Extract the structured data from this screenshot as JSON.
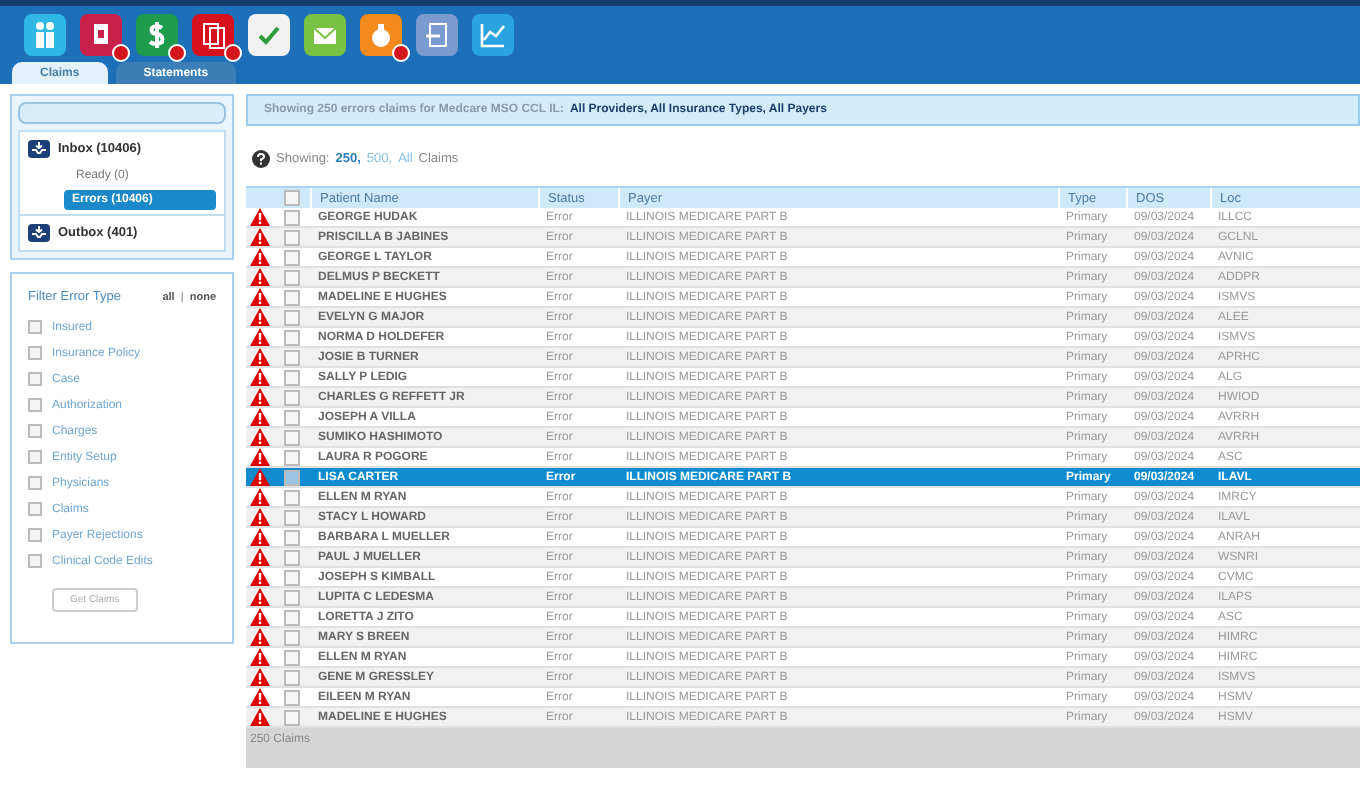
{
  "toolbar": [
    {
      "badge": false
    },
    {
      "badge": true
    },
    {
      "badge": true
    },
    {
      "badge": true
    },
    {
      "badge": false
    },
    {
      "badge": false
    },
    {
      "badge": true
    },
    {
      "badge": false
    },
    {
      "badge": false
    }
  ],
  "tabs": [
    {
      "label": "Claims",
      "selected": true
    },
    {
      "label": "Statements",
      "selected": false
    }
  ],
  "mailbox": {
    "inbox": "Inbox (10406)",
    "children": [
      {
        "label": "Ready (0)",
        "selected": false
      },
      {
        "label": "Errors (10406)",
        "selected": true
      }
    ],
    "outbox": "Outbox (401)"
  },
  "filter": {
    "title": "Filter Error Type",
    "all": "all",
    "sep": "|",
    "none": "none",
    "items": [
      {
        "label": "Insured",
        "checked": false
      },
      {
        "label": "Insurance Policy",
        "checked": false
      },
      {
        "label": "Case",
        "checked": false
      },
      {
        "label": "Authorization",
        "checked": false
      },
      {
        "label": "Charges",
        "checked": false
      },
      {
        "label": "Entity Setup",
        "checked": false
      },
      {
        "label": "Physicians",
        "checked": false
      },
      {
        "label": "Claims",
        "checked": false
      },
      {
        "label": "Payer Rejections",
        "checked": false
      },
      {
        "label": "Clinical Code Edits",
        "checked": false
      }
    ],
    "button": "Get Claims"
  },
  "banner": {
    "text": "Showing 250 errors claims for Medcare MSO CCL IL:",
    "scope": "All Providers, All Insurance Types, All Payers"
  },
  "showing": {
    "label": "Showing:",
    "options": [
      {
        "label": "250,",
        "selected": true
      },
      {
        "label": "500,",
        "selected": false
      },
      {
        "label": "All",
        "selected": false
      }
    ],
    "suffix": "Claims"
  },
  "table": {
    "select_all_checked": false,
    "columns": [
      "Patient Name",
      "Status",
      "Payer",
      "Type",
      "DOS",
      "Loc"
    ],
    "rows": [
      {
        "name": "GEORGE HUDAK",
        "status": "Error",
        "payer": "ILLINOIS MEDICARE PART B",
        "type": "Primary",
        "dos": "09/03/2024",
        "loc": "ILLCC",
        "selected": false
      },
      {
        "name": "PRISCILLA B JABINES",
        "status": "Error",
        "payer": "ILLINOIS MEDICARE PART B",
        "type": "Primary",
        "dos": "09/03/2024",
        "loc": "GCLNL",
        "selected": false
      },
      {
        "name": "GEORGE L TAYLOR",
        "status": "Error",
        "payer": "ILLINOIS MEDICARE PART B",
        "type": "Primary",
        "dos": "09/03/2024",
        "loc": "AVNIC",
        "selected": false
      },
      {
        "name": "DELMUS P BECKETT",
        "status": "Error",
        "payer": "ILLINOIS MEDICARE PART B",
        "type": "Primary",
        "dos": "09/03/2024",
        "loc": "ADDPR",
        "selected": false
      },
      {
        "name": "MADELINE E HUGHES",
        "status": "Error",
        "payer": "ILLINOIS MEDICARE PART B",
        "type": "Primary",
        "dos": "09/03/2024",
        "loc": "ISMVS",
        "selected": false
      },
      {
        "name": "EVELYN G MAJOR",
        "status": "Error",
        "payer": "ILLINOIS MEDICARE PART B",
        "type": "Primary",
        "dos": "09/03/2024",
        "loc": "ALEE",
        "selected": false
      },
      {
        "name": "NORMA D HOLDEFER",
        "status": "Error",
        "payer": "ILLINOIS MEDICARE PART B",
        "type": "Primary",
        "dos": "09/03/2024",
        "loc": "ISMVS",
        "selected": false
      },
      {
        "name": "JOSIE B TURNER",
        "status": "Error",
        "payer": "ILLINOIS MEDICARE PART B",
        "type": "Primary",
        "dos": "09/03/2024",
        "loc": "APRHC",
        "selected": false
      },
      {
        "name": "SALLY P LEDIG",
        "status": "Error",
        "payer": "ILLINOIS MEDICARE PART B",
        "type": "Primary",
        "dos": "09/03/2024",
        "loc": "ALG",
        "selected": false
      },
      {
        "name": "CHARLES G REFFETT JR",
        "status": "Error",
        "payer": "ILLINOIS MEDICARE PART B",
        "type": "Primary",
        "dos": "09/03/2024",
        "loc": "HWIOD",
        "selected": false
      },
      {
        "name": "JOSEPH A VILLA",
        "status": "Error",
        "payer": "ILLINOIS MEDICARE PART B",
        "type": "Primary",
        "dos": "09/03/2024",
        "loc": "AVRRH",
        "selected": false
      },
      {
        "name": "SUMIKO HASHIMOTO",
        "status": "Error",
        "payer": "ILLINOIS MEDICARE PART B",
        "type": "Primary",
        "dos": "09/03/2024",
        "loc": "AVRRH",
        "selected": false
      },
      {
        "name": "LAURA R POGORE",
        "status": "Error",
        "payer": "ILLINOIS MEDICARE PART B",
        "type": "Primary",
        "dos": "09/03/2024",
        "loc": "ASC",
        "selected": false
      },
      {
        "name": "LISA CARTER",
        "status": "Error",
        "payer": "ILLINOIS MEDICARE PART B",
        "type": "Primary",
        "dos": "09/03/2024",
        "loc": "ILAVL",
        "selected": true
      },
      {
        "name": "ELLEN M RYAN",
        "status": "Error",
        "payer": "ILLINOIS MEDICARE PART B",
        "type": "Primary",
        "dos": "09/03/2024",
        "loc": "IMRCY",
        "selected": false
      },
      {
        "name": "STACY L HOWARD",
        "status": "Error",
        "payer": "ILLINOIS MEDICARE PART B",
        "type": "Primary",
        "dos": "09/03/2024",
        "loc": "ILAVL",
        "selected": false
      },
      {
        "name": "BARBARA L MUELLER",
        "status": "Error",
        "payer": "ILLINOIS MEDICARE PART B",
        "type": "Primary",
        "dos": "09/03/2024",
        "loc": "ANRAH",
        "selected": false
      },
      {
        "name": "PAUL J MUELLER",
        "status": "Error",
        "payer": "ILLINOIS MEDICARE PART B",
        "type": "Primary",
        "dos": "09/03/2024",
        "loc": "WSNRI",
        "selected": false
      },
      {
        "name": "JOSEPH S KIMBALL",
        "status": "Error",
        "payer": "ILLINOIS MEDICARE PART B",
        "type": "Primary",
        "dos": "09/03/2024",
        "loc": "CVMC",
        "selected": false
      },
      {
        "name": "LUPITA C LEDESMA",
        "status": "Error",
        "payer": "ILLINOIS MEDICARE PART B",
        "type": "Primary",
        "dos": "09/03/2024",
        "loc": "ILAPS",
        "selected": false
      },
      {
        "name": "LORETTA J ZITO",
        "status": "Error",
        "payer": "ILLINOIS MEDICARE PART B",
        "type": "Primary",
        "dos": "09/03/2024",
        "loc": "ASC",
        "selected": false
      },
      {
        "name": "MARY S BREEN",
        "status": "Error",
        "payer": "ILLINOIS MEDICARE PART B",
        "type": "Primary",
        "dos": "09/03/2024",
        "loc": "HIMRC",
        "selected": false
      },
      {
        "name": "ELLEN M RYAN",
        "status": "Error",
        "payer": "ILLINOIS MEDICARE PART B",
        "type": "Primary",
        "dos": "09/03/2024",
        "loc": "HIMRC",
        "selected": false
      },
      {
        "name": "GENE M GRESSLEY",
        "status": "Error",
        "payer": "ILLINOIS MEDICARE PART B",
        "type": "Primary",
        "dos": "09/03/2024",
        "loc": "ISMVS",
        "selected": false
      },
      {
        "name": "EILEEN M RYAN",
        "status": "Error",
        "payer": "ILLINOIS MEDICARE PART B",
        "type": "Primary",
        "dos": "09/03/2024",
        "loc": "HSMV",
        "selected": false
      },
      {
        "name": "MADELINE E HUGHES",
        "status": "Error",
        "payer": "ILLINOIS MEDICARE PART B",
        "type": "Primary",
        "dos": "09/03/2024",
        "loc": "HSMV",
        "selected": false
      }
    ],
    "footer": "250 Claims"
  }
}
